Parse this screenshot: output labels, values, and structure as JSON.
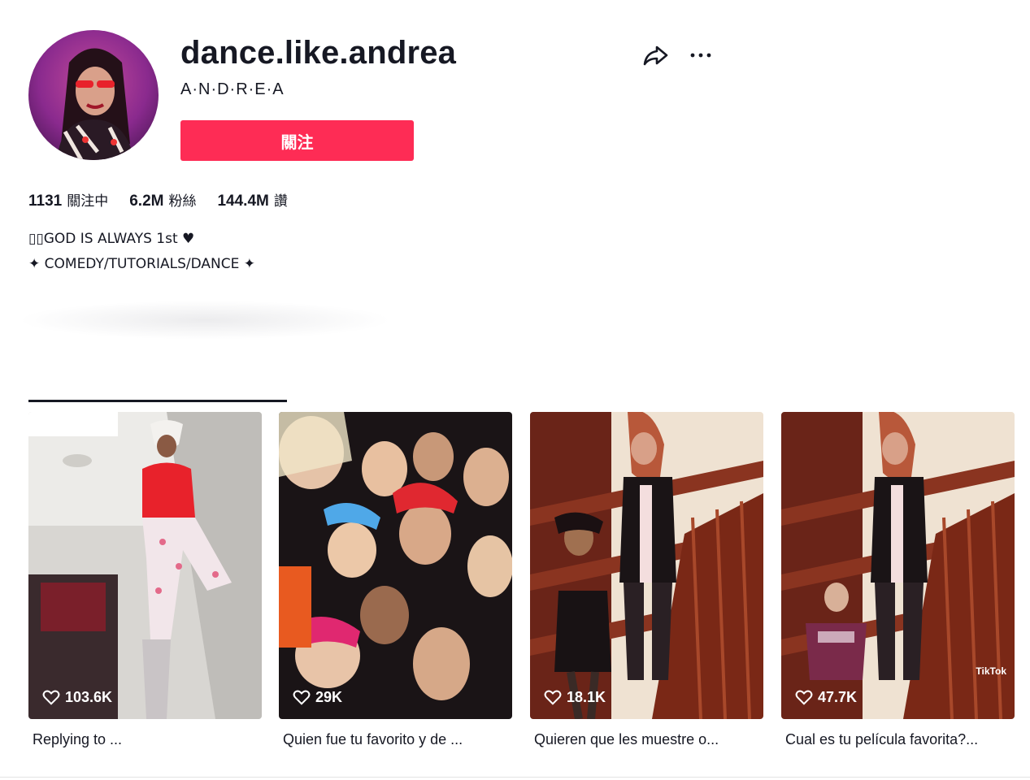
{
  "profile": {
    "username": "dance.like.andrea",
    "nickname": "A·N·D·R·E·A",
    "follow_label": "關注"
  },
  "icons": {
    "share": "share-icon",
    "more": "more-icon",
    "heart": "heart-icon"
  },
  "stats": [
    {
      "value": "1131",
      "label": "關注中"
    },
    {
      "value": "6.2M",
      "label": "粉絲"
    },
    {
      "value": "144.4M",
      "label": "讚"
    }
  ],
  "bio": {
    "line1": "▯▯GOD IS ALWAYS 1st ♥",
    "line2": "✦ COMEDY/TUTORIALS/DANCE ✦"
  },
  "videos": [
    {
      "likes": "103.6K",
      "caption": "Replying to ..."
    },
    {
      "likes": "29K",
      "caption": "Quien fue tu favorito y de ..."
    },
    {
      "likes": "18.1K",
      "caption": "Quieren que les muestre o..."
    },
    {
      "likes": "47.7K",
      "caption": "Cual es tu película favorita?...",
      "watermark": "TikTok"
    }
  ],
  "colors": {
    "accent": "#fe2c55",
    "text": "#161823"
  }
}
